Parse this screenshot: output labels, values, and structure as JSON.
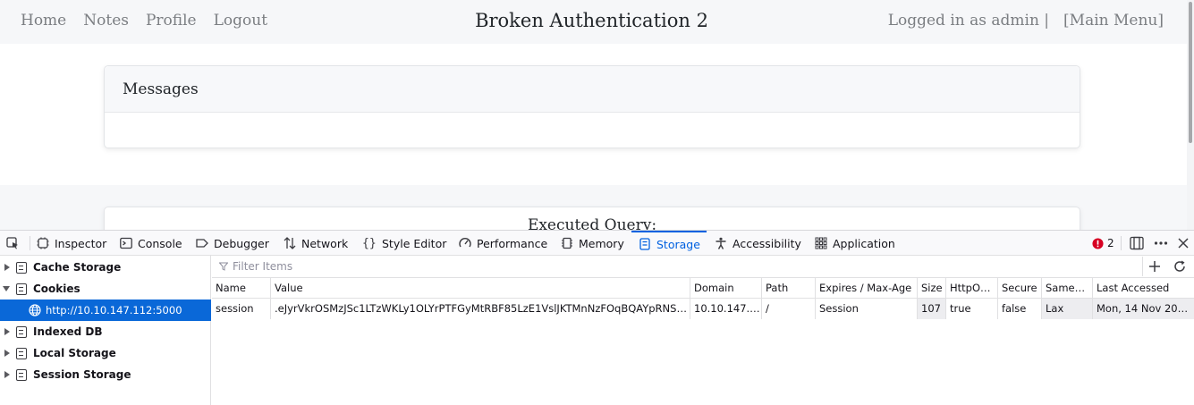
{
  "page": {
    "nav_links": [
      "Home",
      "Notes",
      "Profile",
      "Logout"
    ],
    "brand": "Broken Authentication 2",
    "logged_in_text": "Logged in as admin |",
    "main_menu_link": "[Main Menu]",
    "messages_title": "Messages",
    "executed_query_title": "Executed Query:"
  },
  "devtools": {
    "tabs": [
      {
        "label": "Inspector",
        "icon": "inspector-icon"
      },
      {
        "label": "Console",
        "icon": "console-icon"
      },
      {
        "label": "Debugger",
        "icon": "debugger-icon"
      },
      {
        "label": "Network",
        "icon": "network-icon"
      },
      {
        "label": "Style Editor",
        "icon": "style-editor-icon"
      },
      {
        "label": "Performance",
        "icon": "performance-icon"
      },
      {
        "label": "Memory",
        "icon": "memory-icon"
      },
      {
        "label": "Storage",
        "icon": "storage-icon"
      },
      {
        "label": "Accessibility",
        "icon": "accessibility-icon"
      },
      {
        "label": "Application",
        "icon": "application-icon"
      }
    ],
    "selected_tab": "Storage",
    "error_count": "2",
    "accent_color": "#0061e0",
    "sidebar": [
      {
        "label": "Cache Storage",
        "expanded": false
      },
      {
        "label": "Cookies",
        "expanded": true
      },
      {
        "label": "http://10.10.147.112:5000",
        "selected": true
      },
      {
        "label": "Indexed DB",
        "expanded": false
      },
      {
        "label": "Local Storage",
        "expanded": false
      },
      {
        "label": "Session Storage",
        "expanded": false
      }
    ],
    "filter_placeholder": "Filter Items",
    "table": {
      "headers": [
        "Name",
        "Value",
        "Domain",
        "Path",
        "Expires / Max-Age",
        "Size",
        "HttpO…",
        "Secure",
        "Same…",
        "Last Accessed"
      ],
      "rows": [
        [
          "session",
          ".eJyrVkrOSMzJSc1LTzWKLy1OLYrPTFGyMtRBF85LzE1VslJKTMnNzFOqBQAYpRNS.Y…",
          "10.10.147.…",
          "/",
          "Session",
          "107",
          "true",
          "false",
          "Lax",
          "Mon, 14 Nov 202…"
        ]
      ]
    }
  }
}
